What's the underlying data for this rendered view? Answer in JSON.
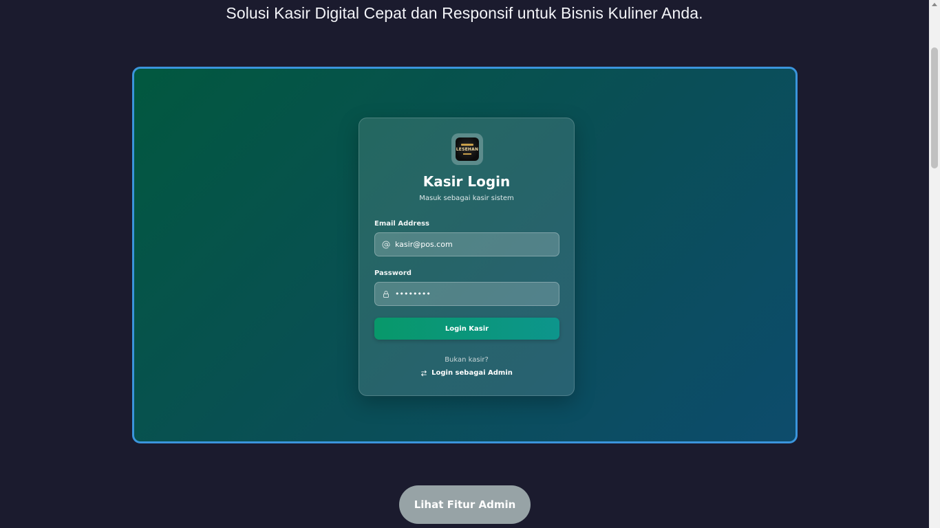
{
  "hero": {
    "tagline": "Solusi Kasir Digital Cepat dan Responsif untuk Bisnis Kuliner Anda."
  },
  "login_card": {
    "logo_text": "LESEHAN",
    "title": "Kasir Login",
    "subtitle": "Masuk sebagai kasir sistem",
    "email": {
      "label": "Email Address",
      "value": "kasir@pos.com",
      "icon": "at-sign-icon"
    },
    "password": {
      "label": "Password",
      "value": "••••••••",
      "icon": "lock-icon"
    },
    "login_button": "Login Kasir",
    "not_kasir_text": "Bukan kasir?",
    "switch_link": "Login sebagai Admin",
    "switch_icon": "swap-arrows-icon"
  },
  "cta_button": "Lihat Fitur Admin",
  "colors": {
    "page_bg": "#1b1b2e",
    "frame_border": "#3b95dc",
    "button_green": "#08986a",
    "cta_bg": "#97a3a6"
  }
}
